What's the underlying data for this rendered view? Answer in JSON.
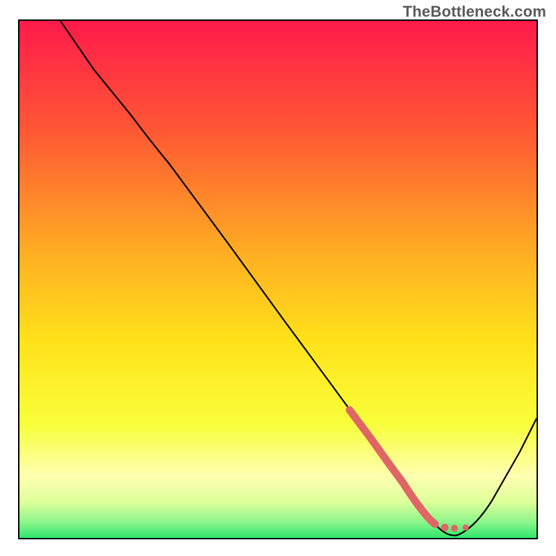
{
  "watermark": {
    "text": "TheBottleneck.com"
  },
  "colors": {
    "gradient_top": "#ff1a4b",
    "gradient_mid1": "#ff7a2a",
    "gradient_mid2": "#ffd21f",
    "gradient_mid3": "#f8ff3a",
    "gradient_lightyellow": "#feffb0",
    "gradient_green": "#2fe76b",
    "curve_stroke": "#000000",
    "accent_stroke": "#e06666"
  },
  "chart_data": {
    "type": "line",
    "title": "",
    "xlabel": "",
    "ylabel": "",
    "x": [
      0,
      5,
      10,
      15,
      20,
      25,
      30,
      35,
      40,
      45,
      50,
      55,
      60,
      65,
      70,
      72,
      74,
      76,
      78,
      80,
      85,
      90,
      95,
      100
    ],
    "series": [
      {
        "name": "bottleneck_curve",
        "values": [
          105,
          95,
          85,
          77,
          73,
          68,
          62,
          56,
          50,
          44,
          38,
          32,
          26,
          20,
          13,
          9,
          6,
          3,
          2,
          0,
          4,
          10,
          17,
          25
        ]
      }
    ],
    "accent_segment": {
      "x": [
        62,
        65,
        68,
        70,
        72,
        74,
        76,
        78,
        80
      ],
      "values": [
        22,
        17,
        12,
        8,
        5,
        3,
        2,
        1.5,
        1
      ]
    },
    "xlim": [
      0,
      100
    ],
    "ylim": [
      0,
      105
    ],
    "legend": false,
    "grid": false
  }
}
